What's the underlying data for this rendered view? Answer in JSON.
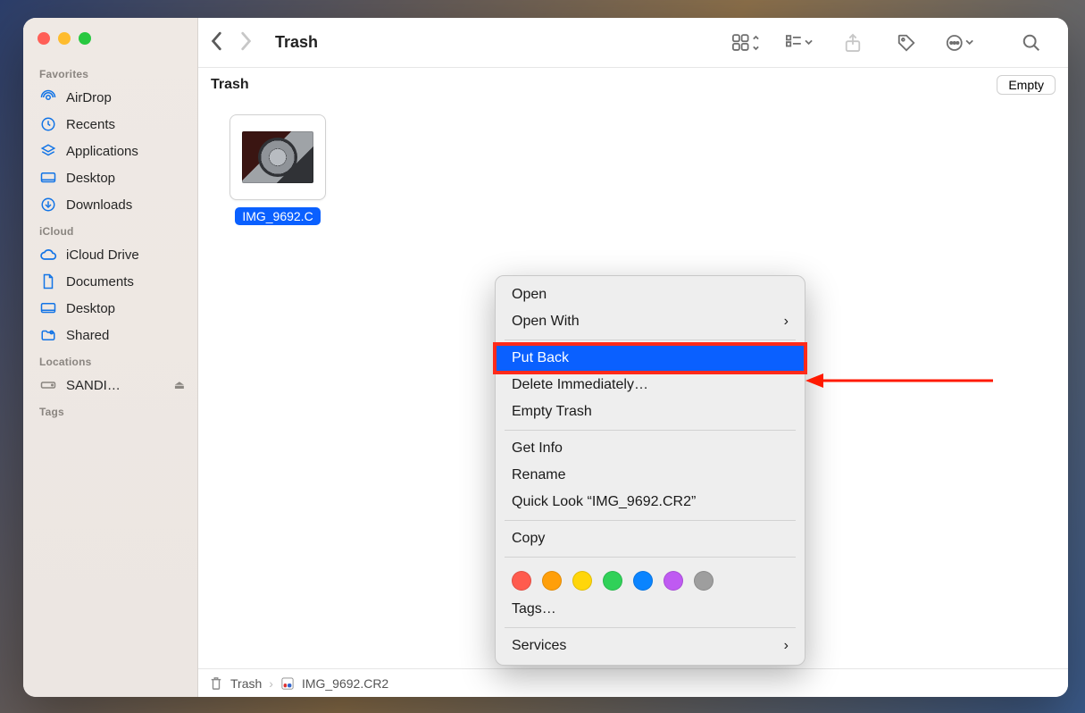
{
  "window": {
    "title": "Trash"
  },
  "sidebar": {
    "sections": {
      "favorites": {
        "label": "Favorites",
        "items": [
          "AirDrop",
          "Recents",
          "Applications",
          "Desktop",
          "Downloads"
        ]
      },
      "icloud": {
        "label": "iCloud",
        "items": [
          "iCloud Drive",
          "Documents",
          "Desktop",
          "Shared"
        ]
      },
      "locations": {
        "label": "Locations",
        "items": [
          "SANDI…"
        ]
      },
      "tags": {
        "label": "Tags"
      }
    }
  },
  "subheader": {
    "title": "Trash",
    "empty_button": "Empty"
  },
  "file": {
    "name": "IMG_9692.CR2",
    "display_truncated": "IMG_9692.C"
  },
  "context_menu": {
    "open": "Open",
    "open_with": "Open With",
    "put_back": "Put Back",
    "delete_immediately": "Delete Immediately…",
    "empty_trash": "Empty Trash",
    "get_info": "Get Info",
    "rename": "Rename",
    "quick_look": "Quick Look “IMG_9692.CR2”",
    "copy": "Copy",
    "tags": "Tags…",
    "services": "Services",
    "highlighted": "put_back",
    "tag_colors": [
      "red",
      "orange",
      "yellow",
      "green",
      "blue",
      "purple",
      "gray"
    ]
  },
  "pathbar": {
    "root": "Trash",
    "file": "IMG_9692.CR2"
  }
}
